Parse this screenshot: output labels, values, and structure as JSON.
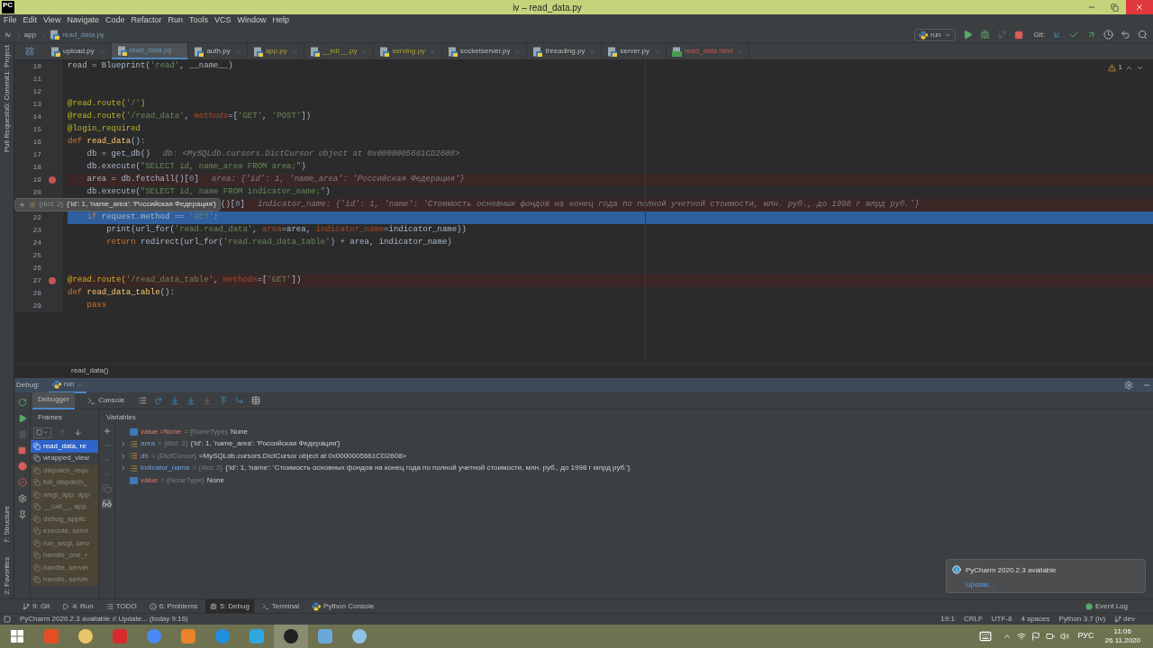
{
  "window": {
    "logo": "PC",
    "title": "iv – read_data.py"
  },
  "menu": [
    "File",
    "Edit",
    "View",
    "Navigate",
    "Code",
    "Refactor",
    "Run",
    "Tools",
    "VCS",
    "Window",
    "Help"
  ],
  "breadcrumbs": [
    "iv",
    "app",
    "read_data.py"
  ],
  "run_config": {
    "label": "run"
  },
  "git_label": "Git:",
  "left_tools": [
    {
      "label": "1: Project"
    },
    {
      "label": "0: Commit"
    },
    {
      "label": "Pull Requests"
    }
  ],
  "left_tools_bottom": [
    {
      "label": "7: Structure"
    },
    {
      "label": "2: Favorites"
    }
  ],
  "tabs": [
    {
      "label": "upload.py",
      "selected": false,
      "kind": "unchanged"
    },
    {
      "label": "read_data.py",
      "selected": true,
      "kind": "modified"
    },
    {
      "label": "auth.py",
      "selected": false,
      "kind": "unchanged"
    },
    {
      "label": "app.py",
      "selected": false,
      "kind": "library"
    },
    {
      "label": "__init__.py",
      "selected": false,
      "kind": "library"
    },
    {
      "label": "serving.py",
      "selected": false,
      "kind": "library"
    },
    {
      "label": "socketserver.py",
      "selected": false,
      "kind": "unchanged"
    },
    {
      "label": "threading.py",
      "selected": false,
      "kind": "unchanged"
    },
    {
      "label": "server.py",
      "selected": false,
      "kind": "unchanged"
    },
    {
      "label": "read_data.html",
      "selected": false,
      "kind": "error"
    }
  ],
  "editor": {
    "warning_count": "1",
    "breadcrumb": "read_data()",
    "lines": [
      {
        "number": "10",
        "breakpoint": false,
        "current": false,
        "tokens": [
          {
            "kind": "plain",
            "text": "read = Blueprint("
          },
          {
            "kind": "string",
            "text": "'read'"
          },
          {
            "kind": "plain",
            "text": ", __name__)"
          }
        ]
      },
      {
        "number": "11",
        "breakpoint": false,
        "current": false
      },
      {
        "number": "12",
        "breakpoint": false,
        "current": false
      },
      {
        "number": "13",
        "breakpoint": false,
        "current": false,
        "tokens": [
          {
            "kind": "decorator",
            "text": "@read.route("
          },
          {
            "kind": "string",
            "text": "'/'"
          },
          {
            "kind": "decorator",
            "text": ")"
          }
        ]
      },
      {
        "number": "14",
        "breakpoint": false,
        "current": false,
        "tokens": [
          {
            "kind": "decorator",
            "text": "@read.route("
          },
          {
            "kind": "string",
            "text": "'/read_data'"
          },
          {
            "kind": "plain",
            "text": ", "
          },
          {
            "kind": "param",
            "text": "methods"
          },
          {
            "kind": "plain",
            "text": "=["
          },
          {
            "kind": "string",
            "text": "'GET'"
          },
          {
            "kind": "plain",
            "text": ", "
          },
          {
            "kind": "string",
            "text": "'POST'"
          },
          {
            "kind": "plain",
            "text": "])"
          }
        ]
      },
      {
        "number": "15",
        "breakpoint": false,
        "current": false,
        "tokens": [
          {
            "kind": "decorator",
            "text": "@login_required"
          }
        ]
      },
      {
        "number": "16",
        "breakpoint": false,
        "current": false,
        "tokens": [
          {
            "kind": "keyword",
            "text": "def "
          },
          {
            "kind": "func",
            "text": "read_data"
          },
          {
            "kind": "plain",
            "text": "():"
          }
        ]
      },
      {
        "number": "17",
        "breakpoint": false,
        "current": false,
        "tokens": [
          {
            "kind": "plain",
            "text": "    db = get_db()"
          }
        ],
        "hint": "db: <MySQLdb.cursors.DictCursor object at 0x0000005661CD2608>"
      },
      {
        "number": "18",
        "breakpoint": false,
        "current": false,
        "tokens": [
          {
            "kind": "plain",
            "text": "    db.execute("
          },
          {
            "kind": "string",
            "text": "\"SELECT id, name_area FROM area;\""
          },
          {
            "kind": "plain",
            "text": ")"
          }
        ]
      },
      {
        "number": "19",
        "breakpoint": true,
        "current": false,
        "tokens": [
          {
            "kind": "plain",
            "text": "    area = db.fetchall()["
          },
          {
            "kind": "number",
            "text": "0"
          },
          {
            "kind": "plain",
            "text": "]"
          }
        ],
        "hint": "area: {'id': 1, 'name_area': 'Российская Федерация'}"
      },
      {
        "number": "20",
        "breakpoint": false,
        "current": false,
        "tokens": [
          {
            "kind": "plain",
            "text": "    db.execute("
          },
          {
            "kind": "string",
            "text": "\"SELECT id, name FROM indicator_name;\""
          },
          {
            "kind": "plain",
            "text": ")"
          }
        ]
      },
      {
        "breakpoint": true,
        "current": false,
        "popup": {
          "type": "{dict: 2}",
          "value": "{'id': 1, 'name_area': 'Российская Федерация'}"
        },
        "tokens": [
          {
            "kind": "plain",
            "text": "()["
          },
          {
            "kind": "number",
            "text": "0"
          },
          {
            "kind": "plain",
            "text": "]"
          }
        ],
        "hint": "indicator_name: {'id': 1, 'name': 'Стоимость основных фондов на конец года по полной учетной стоимости, млн. руб., до 1998 г млрд руб.'}"
      },
      {
        "number": "22",
        "breakpoint": false,
        "current": true,
        "tokens": [
          {
            "kind": "keyword",
            "text": "    if "
          },
          {
            "kind": "plain",
            "text": "request.method == "
          },
          {
            "kind": "string",
            "text": "'GET'"
          },
          {
            "kind": "plain",
            "text": ":"
          }
        ]
      },
      {
        "number": "23",
        "breakpoint": false,
        "current": false,
        "tokens": [
          {
            "kind": "plain",
            "text": "        print(url_for("
          },
          {
            "kind": "string",
            "text": "'read.read_data'"
          },
          {
            "kind": "plain",
            "text": ", "
          },
          {
            "kind": "param",
            "text": "area"
          },
          {
            "kind": "plain",
            "text": "=area, "
          },
          {
            "kind": "param",
            "text": "indicator_name"
          },
          {
            "kind": "plain",
            "text": "=indicator_name))"
          }
        ]
      },
      {
        "number": "24",
        "breakpoint": false,
        "current": false,
        "tokens": [
          {
            "kind": "keyword",
            "text": "        return "
          },
          {
            "kind": "plain",
            "text": "redirect(url_for("
          },
          {
            "kind": "string",
            "text": "'read.read_data_table'"
          },
          {
            "kind": "plain",
            "text": ") + area, indicator_name)"
          }
        ]
      },
      {
        "number": "25",
        "breakpoint": false,
        "current": false
      },
      {
        "number": "26",
        "breakpoint": false,
        "current": false
      },
      {
        "number": "27",
        "breakpoint": true,
        "current": false,
        "tokens": [
          {
            "kind": "decorator",
            "text": "@read.route("
          },
          {
            "kind": "string",
            "text": "'/read_data_table'"
          },
          {
            "kind": "plain",
            "text": ", "
          },
          {
            "kind": "param",
            "text": "methods"
          },
          {
            "kind": "plain",
            "text": "=["
          },
          {
            "kind": "string",
            "text": "'GET'"
          },
          {
            "kind": "plain",
            "text": "])"
          }
        ]
      },
      {
        "number": "28",
        "breakpoint": false,
        "current": false,
        "tokens": [
          {
            "kind": "keyword",
            "text": "def "
          },
          {
            "kind": "func",
            "text": "read_data_table"
          },
          {
            "kind": "plain",
            "text": "():"
          }
        ]
      },
      {
        "number": "29",
        "breakpoint": false,
        "current": false,
        "tokens": [
          {
            "kind": "keyword",
            "text": "    pass"
          }
        ]
      }
    ]
  },
  "debug": {
    "title": "Debug:",
    "session": "run",
    "tabs": [
      {
        "label": "Debugger",
        "selected": true
      },
      {
        "label": "Console",
        "selected": false
      }
    ],
    "frames_title": "Frames",
    "variables_title": "Variables",
    "frames": [
      {
        "label": "read_data, re",
        "selected": true,
        "library": false
      },
      {
        "label": "wrapped_view",
        "selected": false,
        "library": false
      },
      {
        "label": "dispatch_requ",
        "selected": false,
        "library": true
      },
      {
        "label": "full_dispatch_",
        "selected": false,
        "library": true
      },
      {
        "label": "wsgi_app, app",
        "selected": false,
        "library": true
      },
      {
        "label": "__call__, app.",
        "selected": false,
        "library": true
      },
      {
        "label": "debug_applic",
        "selected": false,
        "library": true
      },
      {
        "label": "execute, servi",
        "selected": false,
        "library": true
      },
      {
        "label": "run_wsgi, serv",
        "selected": false,
        "library": true
      },
      {
        "label": "handle_one_r",
        "selected": false,
        "library": true
      },
      {
        "label": "handle, server",
        "selected": false,
        "library": true
      },
      {
        "label": "handle, servin",
        "selected": false,
        "library": true
      }
    ],
    "variables": [
      {
        "kind": "value",
        "name": "value =None",
        "type": "= {NoneType}",
        "value": "None",
        "expandable": false
      },
      {
        "kind": "dict",
        "name": "area",
        "type": "= {dict: 2}",
        "value": "{'id': 1, 'name_area': 'Российская Федерация'}",
        "expandable": true
      },
      {
        "kind": "dict",
        "name": "db",
        "type": "= {DictCursor}",
        "value": "<MySQLdb.cursors.DictCursor object at 0x0000005661CD2608>",
        "expandable": true
      },
      {
        "kind": "dict",
        "name": "indicator_name",
        "type": "= {dict: 2}",
        "value": "{'id': 1, 'name': 'Стоимость основных фондов на конец года по полной учетной стоимости, млн. руб., до 1998 г млрд руб.'}",
        "expandable": true
      },
      {
        "kind": "value",
        "name": "value",
        "type": "= {NoneType}",
        "value": "None",
        "expandable": false
      }
    ]
  },
  "notification": {
    "title": "PyCharm 2020.2.3 available",
    "link": "Update..."
  },
  "tool_windows": [
    {
      "kind": "git",
      "label": "9: Git",
      "selected": false
    },
    {
      "kind": "run",
      "label": "4: Run",
      "selected": false
    },
    {
      "kind": "todo",
      "label": "TODO",
      "selected": false
    },
    {
      "kind": "problems",
      "label": "6: Problems",
      "selected": false
    },
    {
      "kind": "debug",
      "label": "5: Debug",
      "selected": true
    },
    {
      "kind": "terminal",
      "label": "Terminal",
      "selected": false
    },
    {
      "kind": "console",
      "label": "Python Console",
      "selected": false
    }
  ],
  "event_log": "Event Log",
  "status": {
    "message": "PyCharm 2020.2.3 available // Update... (today 9:16)",
    "items": [
      "19:1",
      "CRLF",
      "UTF-8",
      "4 spaces",
      "Python 3.7 (iv)"
    ],
    "branch": "dev"
  },
  "taskbar": {
    "language": "РУС",
    "time": "11:06",
    "date": "26.11.2020"
  }
}
